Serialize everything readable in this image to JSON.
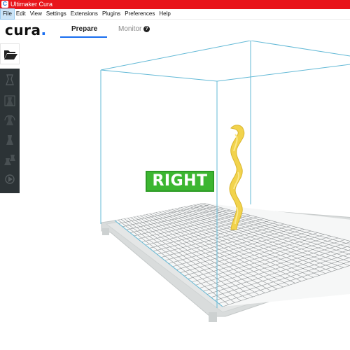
{
  "window": {
    "title": "Ultimaker Cura",
    "icon": "cura-app-icon",
    "icon_glyph": "C",
    "titlebar_color": "#e8151b"
  },
  "menu": {
    "items": [
      "File",
      "Edit",
      "View",
      "Settings",
      "Extensions",
      "Plugins",
      "Preferences",
      "Help"
    ],
    "active": "File"
  },
  "header": {
    "logo_text": "cura",
    "logo_dot": ".",
    "tabs": [
      {
        "label": "Prepare",
        "selected": true
      },
      {
        "label": "Monitor",
        "selected": false
      }
    ],
    "help_glyph": "?",
    "accent_color": "#196ef0"
  },
  "toolbar": {
    "open_file_icon": "folder-open-icon",
    "tools": [
      "move-icon",
      "scale-icon",
      "rotate-icon",
      "mirror-icon",
      "per-model-settings-icon",
      "support-blocker-icon"
    ],
    "panel_color": "#2c3336"
  },
  "viewport": {
    "view_label": "RIGHT",
    "view_label_color": "#3cb631",
    "build_volume_color": "#63b9d6",
    "model_color": "#f2d34c"
  }
}
